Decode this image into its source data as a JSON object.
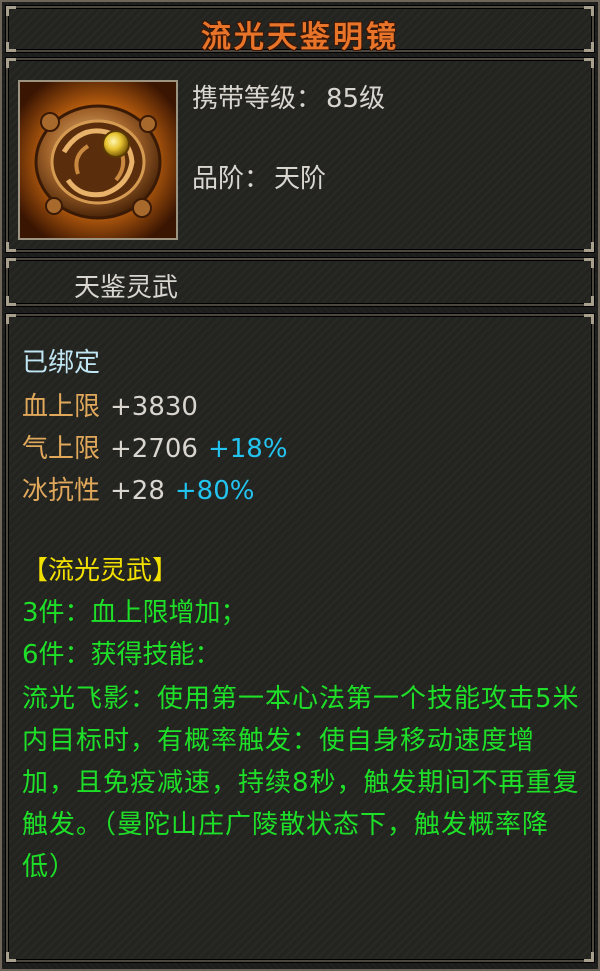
{
  "item": {
    "name": "流光天鉴明镜",
    "level_label": "携带等级：",
    "level_value": "85级",
    "grade_label": "品阶：",
    "grade_value": "天阶",
    "subtitle": "天鉴灵武",
    "icon": "ornate-bronze-mirror-icon"
  },
  "stats": {
    "bound": "已绑定",
    "rows": [
      {
        "name": "血上限",
        "value": "+3830",
        "pct": ""
      },
      {
        "name": "气上限",
        "value": "+2706",
        "pct": "+18%"
      },
      {
        "name": "冰抗性",
        "value": "+28",
        "pct": "+80%"
      }
    ]
  },
  "set": {
    "title": "【流光灵武】",
    "bonus3": "3件：血上限增加；",
    "bonus6": "6件：获得技能：",
    "description": "流光飞影：使用第一本心法第一个技能攻击5米内目标时，有概率触发：使自身移动速度增加，且免疫减速，持续8秒，触发期间不再重复触发。（曼陀山庄广陵散状态下，触发概率降低）"
  },
  "colors": {
    "title": "#e8742a",
    "stat_name": "#e0a85a",
    "percent": "#23c4f0",
    "set_title": "#f2e000",
    "set_text": "#1ee028",
    "bound": "#bfe6f2"
  }
}
